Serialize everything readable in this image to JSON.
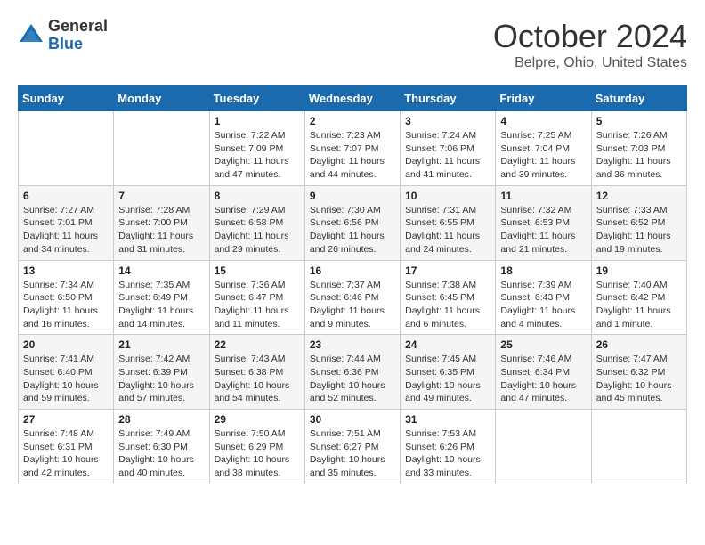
{
  "logo": {
    "general": "General",
    "blue": "Blue"
  },
  "title": "October 2024",
  "location": "Belpre, Ohio, United States",
  "days_of_week": [
    "Sunday",
    "Monday",
    "Tuesday",
    "Wednesday",
    "Thursday",
    "Friday",
    "Saturday"
  ],
  "weeks": [
    [
      {
        "day": "",
        "info": ""
      },
      {
        "day": "",
        "info": ""
      },
      {
        "day": "1",
        "info": "Sunrise: 7:22 AM\nSunset: 7:09 PM\nDaylight: 11 hours and 47 minutes."
      },
      {
        "day": "2",
        "info": "Sunrise: 7:23 AM\nSunset: 7:07 PM\nDaylight: 11 hours and 44 minutes."
      },
      {
        "day": "3",
        "info": "Sunrise: 7:24 AM\nSunset: 7:06 PM\nDaylight: 11 hours and 41 minutes."
      },
      {
        "day": "4",
        "info": "Sunrise: 7:25 AM\nSunset: 7:04 PM\nDaylight: 11 hours and 39 minutes."
      },
      {
        "day": "5",
        "info": "Sunrise: 7:26 AM\nSunset: 7:03 PM\nDaylight: 11 hours and 36 minutes."
      }
    ],
    [
      {
        "day": "6",
        "info": "Sunrise: 7:27 AM\nSunset: 7:01 PM\nDaylight: 11 hours and 34 minutes."
      },
      {
        "day": "7",
        "info": "Sunrise: 7:28 AM\nSunset: 7:00 PM\nDaylight: 11 hours and 31 minutes."
      },
      {
        "day": "8",
        "info": "Sunrise: 7:29 AM\nSunset: 6:58 PM\nDaylight: 11 hours and 29 minutes."
      },
      {
        "day": "9",
        "info": "Sunrise: 7:30 AM\nSunset: 6:56 PM\nDaylight: 11 hours and 26 minutes."
      },
      {
        "day": "10",
        "info": "Sunrise: 7:31 AM\nSunset: 6:55 PM\nDaylight: 11 hours and 24 minutes."
      },
      {
        "day": "11",
        "info": "Sunrise: 7:32 AM\nSunset: 6:53 PM\nDaylight: 11 hours and 21 minutes."
      },
      {
        "day": "12",
        "info": "Sunrise: 7:33 AM\nSunset: 6:52 PM\nDaylight: 11 hours and 19 minutes."
      }
    ],
    [
      {
        "day": "13",
        "info": "Sunrise: 7:34 AM\nSunset: 6:50 PM\nDaylight: 11 hours and 16 minutes."
      },
      {
        "day": "14",
        "info": "Sunrise: 7:35 AM\nSunset: 6:49 PM\nDaylight: 11 hours and 14 minutes."
      },
      {
        "day": "15",
        "info": "Sunrise: 7:36 AM\nSunset: 6:47 PM\nDaylight: 11 hours and 11 minutes."
      },
      {
        "day": "16",
        "info": "Sunrise: 7:37 AM\nSunset: 6:46 PM\nDaylight: 11 hours and 9 minutes."
      },
      {
        "day": "17",
        "info": "Sunrise: 7:38 AM\nSunset: 6:45 PM\nDaylight: 11 hours and 6 minutes."
      },
      {
        "day": "18",
        "info": "Sunrise: 7:39 AM\nSunset: 6:43 PM\nDaylight: 11 hours and 4 minutes."
      },
      {
        "day": "19",
        "info": "Sunrise: 7:40 AM\nSunset: 6:42 PM\nDaylight: 11 hours and 1 minute."
      }
    ],
    [
      {
        "day": "20",
        "info": "Sunrise: 7:41 AM\nSunset: 6:40 PM\nDaylight: 10 hours and 59 minutes."
      },
      {
        "day": "21",
        "info": "Sunrise: 7:42 AM\nSunset: 6:39 PM\nDaylight: 10 hours and 57 minutes."
      },
      {
        "day": "22",
        "info": "Sunrise: 7:43 AM\nSunset: 6:38 PM\nDaylight: 10 hours and 54 minutes."
      },
      {
        "day": "23",
        "info": "Sunrise: 7:44 AM\nSunset: 6:36 PM\nDaylight: 10 hours and 52 minutes."
      },
      {
        "day": "24",
        "info": "Sunrise: 7:45 AM\nSunset: 6:35 PM\nDaylight: 10 hours and 49 minutes."
      },
      {
        "day": "25",
        "info": "Sunrise: 7:46 AM\nSunset: 6:34 PM\nDaylight: 10 hours and 47 minutes."
      },
      {
        "day": "26",
        "info": "Sunrise: 7:47 AM\nSunset: 6:32 PM\nDaylight: 10 hours and 45 minutes."
      }
    ],
    [
      {
        "day": "27",
        "info": "Sunrise: 7:48 AM\nSunset: 6:31 PM\nDaylight: 10 hours and 42 minutes."
      },
      {
        "day": "28",
        "info": "Sunrise: 7:49 AM\nSunset: 6:30 PM\nDaylight: 10 hours and 40 minutes."
      },
      {
        "day": "29",
        "info": "Sunrise: 7:50 AM\nSunset: 6:29 PM\nDaylight: 10 hours and 38 minutes."
      },
      {
        "day": "30",
        "info": "Sunrise: 7:51 AM\nSunset: 6:27 PM\nDaylight: 10 hours and 35 minutes."
      },
      {
        "day": "31",
        "info": "Sunrise: 7:53 AM\nSunset: 6:26 PM\nDaylight: 10 hours and 33 minutes."
      },
      {
        "day": "",
        "info": ""
      },
      {
        "day": "",
        "info": ""
      }
    ]
  ]
}
